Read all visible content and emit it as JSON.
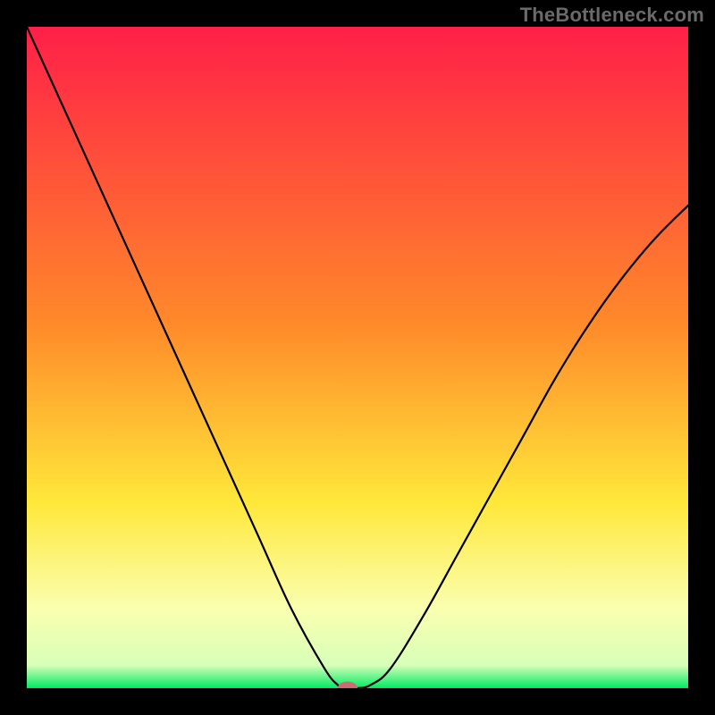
{
  "watermark": "TheBottleneck.com",
  "colors": {
    "background": "#000000",
    "gradient_top": "#ff1f48",
    "gradient_mid1": "#ff8a2a",
    "gradient_mid2": "#ffe83a",
    "gradient_soft": "#faffb0",
    "gradient_green": "#00ea64",
    "curve_stroke": "#000000",
    "marker_fill": "#cf6b70"
  },
  "chart_data": {
    "type": "line",
    "title": "",
    "xlabel": "",
    "ylabel": "",
    "xlim": [
      0,
      100
    ],
    "ylim": [
      0,
      100
    ],
    "grid": false,
    "legend": false,
    "series": [
      {
        "name": "bottleneck-curve",
        "x": [
          0,
          5,
          10,
          15,
          20,
          25,
          30,
          35,
          40,
          45,
          47,
          48,
          50,
          52,
          55,
          60,
          65,
          70,
          75,
          80,
          85,
          90,
          95,
          100
        ],
        "values": [
          100,
          89,
          78,
          67,
          56,
          45,
          34,
          23,
          12,
          3,
          0.5,
          0,
          0,
          0.5,
          3,
          11,
          20,
          29,
          38,
          47,
          55,
          62,
          68,
          73
        ]
      }
    ],
    "marker": {
      "x": 48.5,
      "y": 0,
      "rx_pct": 1.5,
      "ry_pct": 1.0
    },
    "gradient_stops_pct": [
      {
        "offset": 0,
        "color": "#ff1f48"
      },
      {
        "offset": 45,
        "color": "#ff8a2a"
      },
      {
        "offset": 72,
        "color": "#ffe83a"
      },
      {
        "offset": 88,
        "color": "#faffb0"
      },
      {
        "offset": 96.5,
        "color": "#d8ffb8"
      },
      {
        "offset": 100,
        "color": "#00ea64"
      }
    ]
  }
}
